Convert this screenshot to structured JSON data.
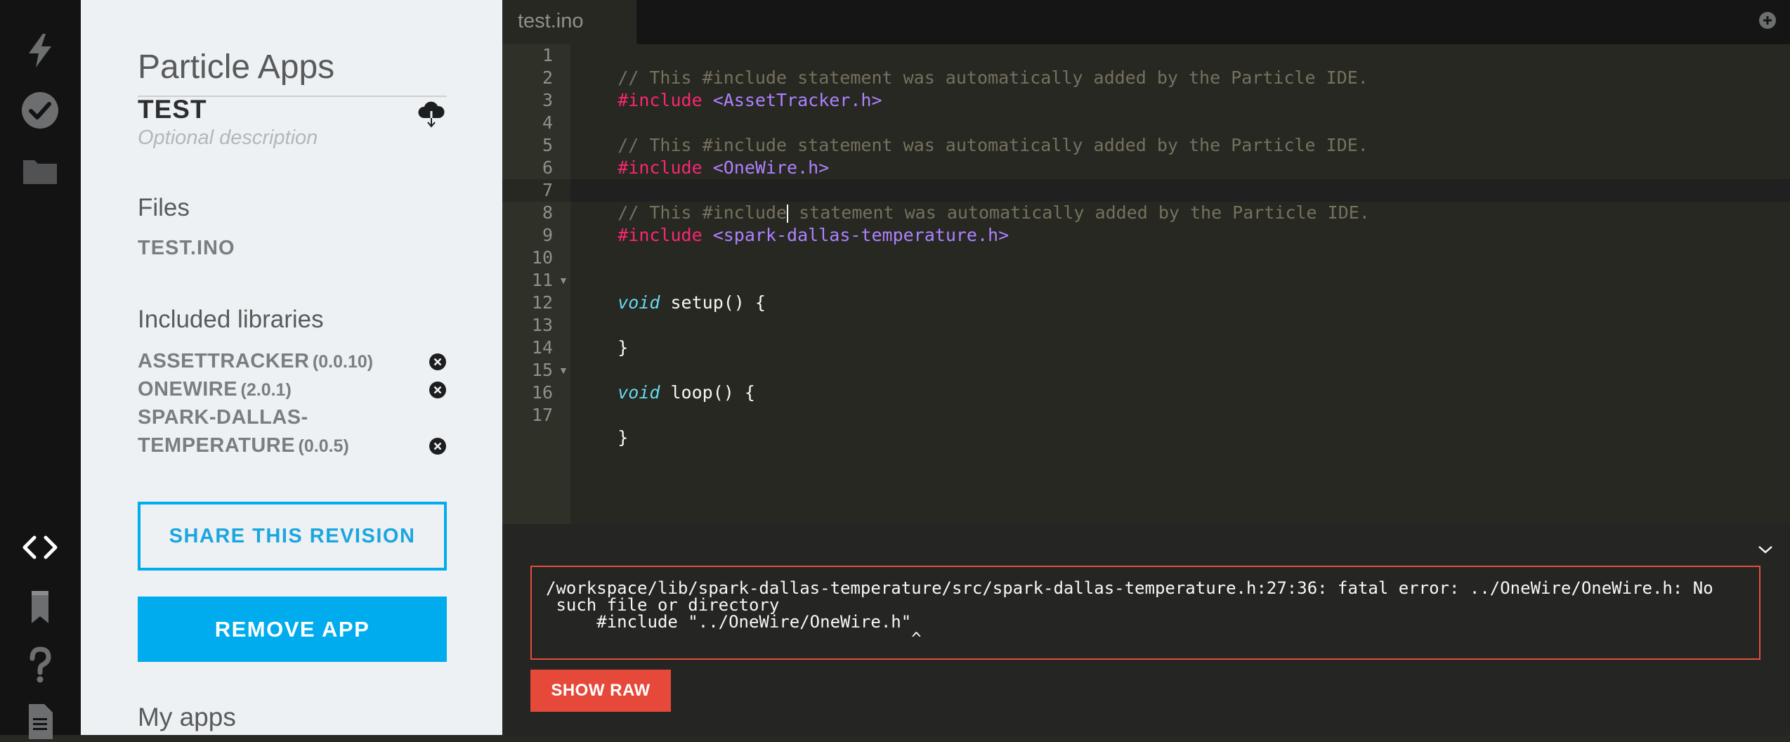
{
  "colors": {
    "accent": "#00acee",
    "error": "#e6493a",
    "rail_bg": "#131313",
    "sidebar_bg": "#eef1f3",
    "editor_bg": "#272822"
  },
  "rail": {
    "icons": [
      "flash-icon",
      "verify-check-icon",
      "folder-icon",
      "code-icon",
      "libraries-bookmark-icon",
      "help-icon",
      "docs-icon"
    ]
  },
  "sidebar": {
    "title": "Particle Apps",
    "app_name": "TEST",
    "description_placeholder": "Optional description",
    "files_heading": "Files",
    "files": [
      "TEST.INO"
    ],
    "libraries_heading": "Included libraries",
    "libraries": [
      {
        "name": "ASSETTRACKER",
        "version": "(0.0.10)"
      },
      {
        "name": "ONEWIRE",
        "version": "(2.0.1)"
      },
      {
        "name": "SPARK-DALLAS-",
        "name2": "TEMPERATURE",
        "version": "(0.0.5)"
      }
    ],
    "share_label": "SHARE THIS REVISION",
    "remove_label": "REMOVE APP",
    "myapps_heading": "My apps"
  },
  "editor": {
    "tab_name": "test.ino",
    "line_numbers": [
      "1",
      "2",
      "3",
      "4",
      "5",
      "6",
      "7",
      "8",
      "9",
      "10",
      "11",
      "12",
      "13",
      "14",
      "15",
      "16",
      "17"
    ],
    "lines": {
      "l1": "// This #include statement was automatically added by the Particle IDE.",
      "l2_kw": "#include",
      "l2_lib": "<AssetTracker.h>",
      "l4": "// This #include statement was automatically added by the Particle IDE.",
      "l5_kw": "#include",
      "l5_lib": "<OneWire.h>",
      "l7_a": "// This #include",
      "l7_b": " statement was automatically added by the Particle IDE.",
      "l8_kw": "#include",
      "l8_lib": "<spark-dallas-temperature.h>",
      "l11_type": "void",
      "l11_rest": " setup() {",
      "l13": "}",
      "l15_type": "void",
      "l15_rest": " loop() {",
      "l17": "}"
    }
  },
  "console": {
    "error_line1": "/workspace/lib/spark-dallas-temperature/src/spark-dallas-temperature.h:27:36: fatal error: ../OneWire/OneWire.h: No",
    "error_line2": " such file or directory",
    "error_line3": "     #include \"../OneWire/OneWire.h\"",
    "error_line4": "                                    ^",
    "show_raw_label": "SHOW RAW"
  }
}
